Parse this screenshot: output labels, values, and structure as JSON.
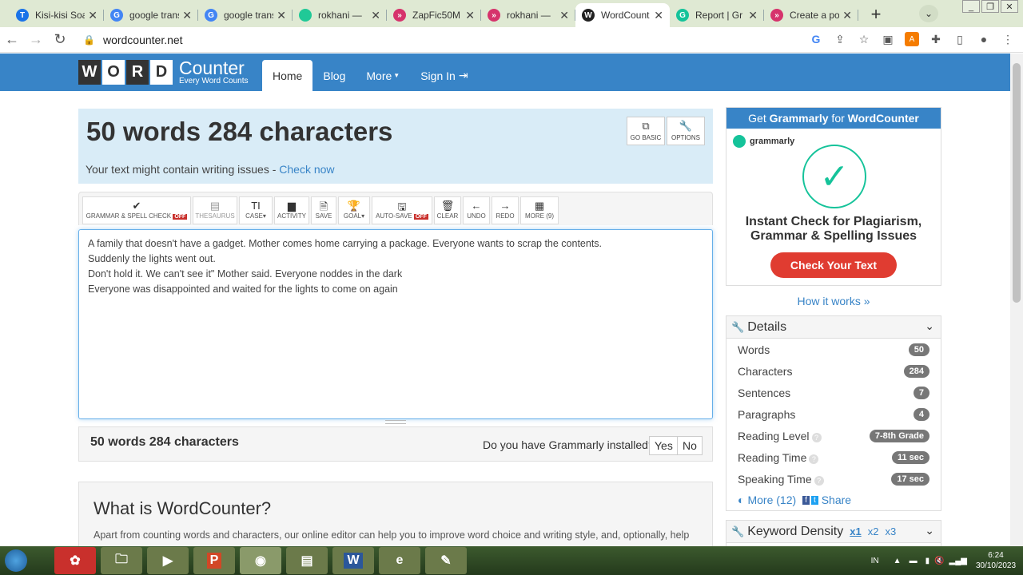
{
  "browser": {
    "tabs": [
      {
        "title": "Kisi-kisi Soal",
        "icon": "t-icon",
        "color": "#1a73e8",
        "letter": "T"
      },
      {
        "title": "google trans",
        "icon": "google-icon",
        "color": "#4285f4",
        "letter": "G"
      },
      {
        "title": "google trans",
        "icon": "google-icon",
        "color": "#4285f4",
        "letter": "G"
      },
      {
        "title": "rokhani — ",
        "icon": "loop-icon",
        "color": "#20c997",
        "letter": ""
      },
      {
        "title": "ZapFic50M",
        "icon": "zap-icon",
        "color": "#d6336c",
        "letter": "»"
      },
      {
        "title": "rokhani — ",
        "icon": "zap-icon",
        "color": "#d6336c",
        "letter": "»"
      },
      {
        "title": "WordCount",
        "icon": "w-icon",
        "color": "#222222",
        "letter": "W",
        "active": true
      },
      {
        "title": "Report | Gr",
        "icon": "grammarly-icon",
        "color": "#15c39a",
        "letter": "G"
      },
      {
        "title": "Create a po",
        "icon": "zap-icon",
        "color": "#d6336c",
        "letter": "»"
      }
    ],
    "url": "wordcounter.net"
  },
  "nav": {
    "logo_letters": [
      "W",
      "O",
      "R",
      "D"
    ],
    "logo_word": "Counter",
    "logo_tagline": "Every Word Counts",
    "links": [
      "Home",
      "Blog",
      "More",
      "Sign In"
    ]
  },
  "counter": {
    "headline": "50 words 284 characters",
    "issues_text": "Your text might contain writing issues - ",
    "issues_link": "Check now",
    "go_basic": "GO BASIC",
    "options": "OPTIONS"
  },
  "toolbar": {
    "grammar": "GRAMMAR & SPELL CHECK",
    "off": "OFF",
    "thesaurus": "THESAURUS",
    "case": "CASE",
    "activity": "ACTIVITY",
    "save": "SAVE",
    "goal": "GOAL",
    "autosave": "AUTO-SAVE",
    "clear": "CLEAR",
    "undo": "UNDO",
    "redo": "REDO",
    "more": "MORE (9)"
  },
  "editor": {
    "lines": [
      "A family that doesn't have a gadget. Mother  comes home carrying a package. Everyone wants to scrap  the contents.",
      "Suddenly the lights went out.",
      "Don't hold it. We can't see it\" Mother said.  Everyone noddes in the dark",
      "Everyone was disappointed and waited for the lights to come on again"
    ]
  },
  "footer_count": {
    "text": "50 words 284 characters",
    "question": "Do you have Grammarly installed?",
    "yes": "Yes",
    "no": "No"
  },
  "what": {
    "title": "What is WordCounter?",
    "body": "Apart from counting words and characters, our online editor can help you to improve word choice and writing style, and, optionally, help you to detect grammar mistakes and plagiarism. To check word count, simply place your cursor into the text box above and"
  },
  "ad": {
    "bar_prefix": "Get ",
    "bar_brand": "Grammarly",
    "bar_mid": " for ",
    "bar_site": "WordCounter",
    "logo": "grammarly",
    "headline_1": "Instant Check for Plagiarism,",
    "headline_2": "Grammar & Spelling Issues",
    "cta": "Check Your Text",
    "how": "How it works »"
  },
  "details": {
    "title": "Details",
    "rows": [
      {
        "label": "Words",
        "value": "50",
        "help": false
      },
      {
        "label": "Characters",
        "value": "284",
        "help": false
      },
      {
        "label": "Sentences",
        "value": "7",
        "help": false
      },
      {
        "label": "Paragraphs",
        "value": "4",
        "help": false
      },
      {
        "label": "Reading Level",
        "value": "7-8th Grade",
        "help": true
      },
      {
        "label": "Reading Time",
        "value": "11 sec",
        "help": true
      },
      {
        "label": "Speaking Time",
        "value": "17 sec",
        "help": true
      }
    ],
    "more": "More (12)",
    "share": "Share"
  },
  "keyword": {
    "title": "Keyword Density",
    "x1": "x1",
    "x2": "x2",
    "x3": "x3"
  },
  "taskbar": {
    "lang": "IN",
    "time": "6:24",
    "date": "30/10/2023"
  }
}
